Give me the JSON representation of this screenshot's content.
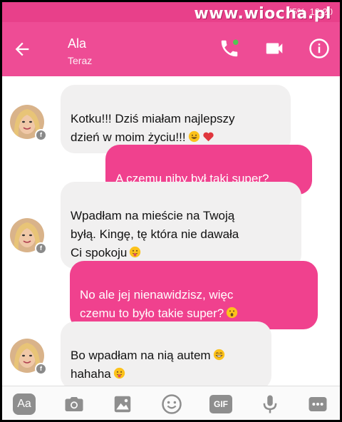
{
  "watermark": "www.wiocha.pl",
  "status_bar": {
    "battery": "75%",
    "time": "12:20"
  },
  "header": {
    "name": "Ala",
    "status": "Teraz"
  },
  "messages": [
    {
      "from": "them",
      "text": "Kotku!!! Dziś miałam najlepszy\ndzień w moim życiu!!!",
      "emoji": [
        "grin-emoji",
        "heart-emoji"
      ]
    },
    {
      "from": "me",
      "text": "A czemu niby był taki super?",
      "emoji": []
    },
    {
      "from": "them",
      "text": "Wpadłam na mieście na Twoją\nbyłą. Kingę, tę która nie dawała\nCi spokoju",
      "emoji": [
        "tongue-emoji"
      ]
    },
    {
      "from": "me",
      "text": "No ale jej nienawidzisz, więc\nczemu to było takie super?",
      "emoji": [
        "surprised-emoji"
      ]
    },
    {
      "from": "them",
      "text": "Bo wpadłam na nią autem",
      "emoji": [
        "laugh-emoji"
      ],
      "text2": "hahaha",
      "emoji2": [
        "tongue-emoji"
      ]
    }
  ],
  "composer": {
    "aa_label": "Aa",
    "gif_label": "GIF"
  },
  "colors": {
    "header": "#ee4c95",
    "outgoing_bubble": "#f0418e",
    "incoming_bubble": "#f1f0f0"
  }
}
